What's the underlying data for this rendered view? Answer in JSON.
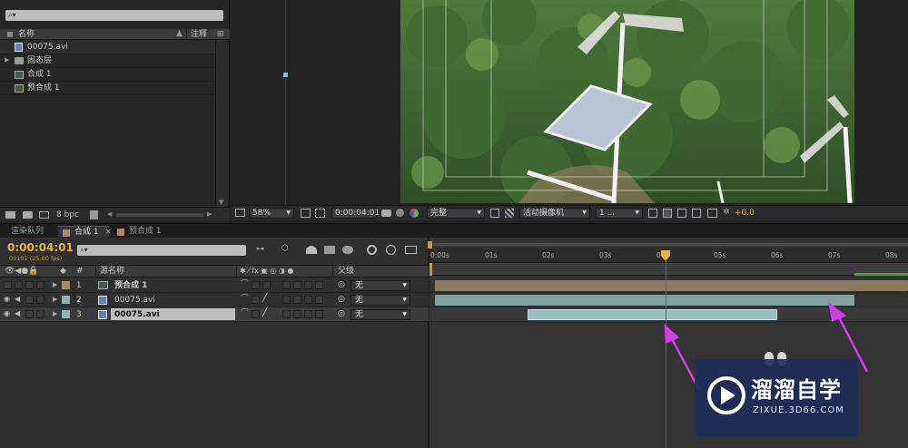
{
  "project": {
    "search_icon_label": "⌕▾",
    "col_name": "名称",
    "col_comment": "注释",
    "items": [
      {
        "name": "00075.avi",
        "icon": "video-file-icon"
      },
      {
        "name": "固态层",
        "icon": "folder-icon"
      },
      {
        "name": "合成 1",
        "icon": "composition-icon"
      },
      {
        "name": "预合成 1",
        "icon": "composition-icon"
      }
    ],
    "bpc": "8 bpc"
  },
  "viewer": {
    "zoom": "58%",
    "timecode": "0:00:04:01",
    "resolution": "完整",
    "camera": "活动摄像机",
    "views": "1 ...",
    "exposure": "+0.0"
  },
  "timeline": {
    "tabs": [
      "渲染队列",
      "合成 1",
      "预合成 1"
    ],
    "current_time": "0:00:04:01",
    "frame_info": "00101 (25.00 fps)",
    "search_icon_label": "⌕▾",
    "col_number": "#",
    "col_source_name": "源名称",
    "col_parent": "父级",
    "layers": [
      {
        "num": "1",
        "name": "预合成 1",
        "parent": "无",
        "color": "#a6895f"
      },
      {
        "num": "2",
        "name": "00075.avi",
        "parent": "无",
        "color": "#8fb3b3"
      },
      {
        "num": "3",
        "name": "00075.avi",
        "parent": "无",
        "color": "#8fb3b3"
      }
    ],
    "ruler": [
      "0:00s",
      "01s",
      "02s",
      "03s",
      "04s",
      "05s",
      "06s",
      "07s",
      "08s"
    ]
  },
  "watermark": {
    "title": "溜溜自学",
    "url": "ZIXUE.3D66.COM"
  }
}
